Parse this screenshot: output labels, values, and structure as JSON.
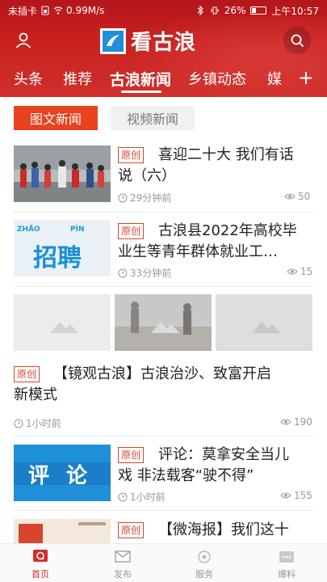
{
  "status_bar": {
    "left_text": "未插卡",
    "speed": "0.99M/s",
    "battery_percent": "26%",
    "battery_level": 0.26,
    "time": "上午10:57"
  },
  "header": {
    "app_title": "看古浪"
  },
  "tabs": [
    {
      "label": "头条"
    },
    {
      "label": "推荐"
    },
    {
      "label": "古浪新闻"
    },
    {
      "label": "乡镇动态"
    },
    {
      "label": "媒"
    }
  ],
  "tab_add": "+",
  "subtabs": {
    "active": "图文新闻",
    "inactive": "视频新闻"
  },
  "articles": [
    {
      "tag": "原创",
      "title_l1": "喜迎二十大 我们有话",
      "title_l2": "说（六）",
      "time": "29分钟前",
      "views": "50"
    },
    {
      "tag": "原创",
      "title_l1": "古浪县2022年高校毕",
      "title_l2": "业生等青年群体就业工…",
      "time": "33分钟前",
      "views": "15",
      "thumb_big": "招聘",
      "thumb_small_left": "ZHĀO",
      "thumb_small_right": "PÌN"
    },
    {
      "tag": "原创",
      "title_l1": "【镜观古浪】古浪治沙、致富开启",
      "title_l2": "新模式",
      "time": "1小时前",
      "views": "190"
    },
    {
      "tag": "原创",
      "title_l1": "评论：莫拿安全当儿",
      "title_l2": "戏 非法载客“驶不得”",
      "time": "1小时前",
      "views": "155",
      "thumb_text": "评 论"
    },
    {
      "tag": "原创",
      "title_l1": "【微海报】我们这十"
    }
  ],
  "bottom_nav": [
    {
      "label": "首页"
    },
    {
      "label": "发布"
    },
    {
      "label": "服务"
    },
    {
      "label": "爆料"
    }
  ],
  "colors": {
    "brand_red": "#c8201f",
    "accent_orange": "#e8421f",
    "tag_red": "#d5452c",
    "thumb_blue": "#1f8fd8"
  }
}
